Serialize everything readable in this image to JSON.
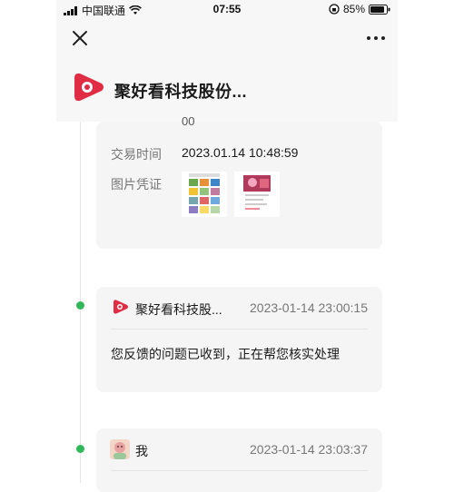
{
  "status_bar": {
    "carrier": "中国联通",
    "time": "07:55",
    "battery": "85%"
  },
  "header": {
    "title": "聚好看科技股份..."
  },
  "order_card": {
    "partial_text": "00",
    "trade_time_label": "交易时间",
    "trade_time_value": "2023.01.14 10:48:59",
    "receipt_label": "图片凭证"
  },
  "messages": [
    {
      "sender": "聚好看科技股...",
      "time": "2023-01-14 23:00:15",
      "text": "您反馈的问题已收到，正在帮您核实处理"
    },
    {
      "sender": "我",
      "time": "2023-01-14 23:03:37"
    }
  ],
  "colors": {
    "brand": "#e02d44",
    "timeline_dot": "#31b85a"
  }
}
